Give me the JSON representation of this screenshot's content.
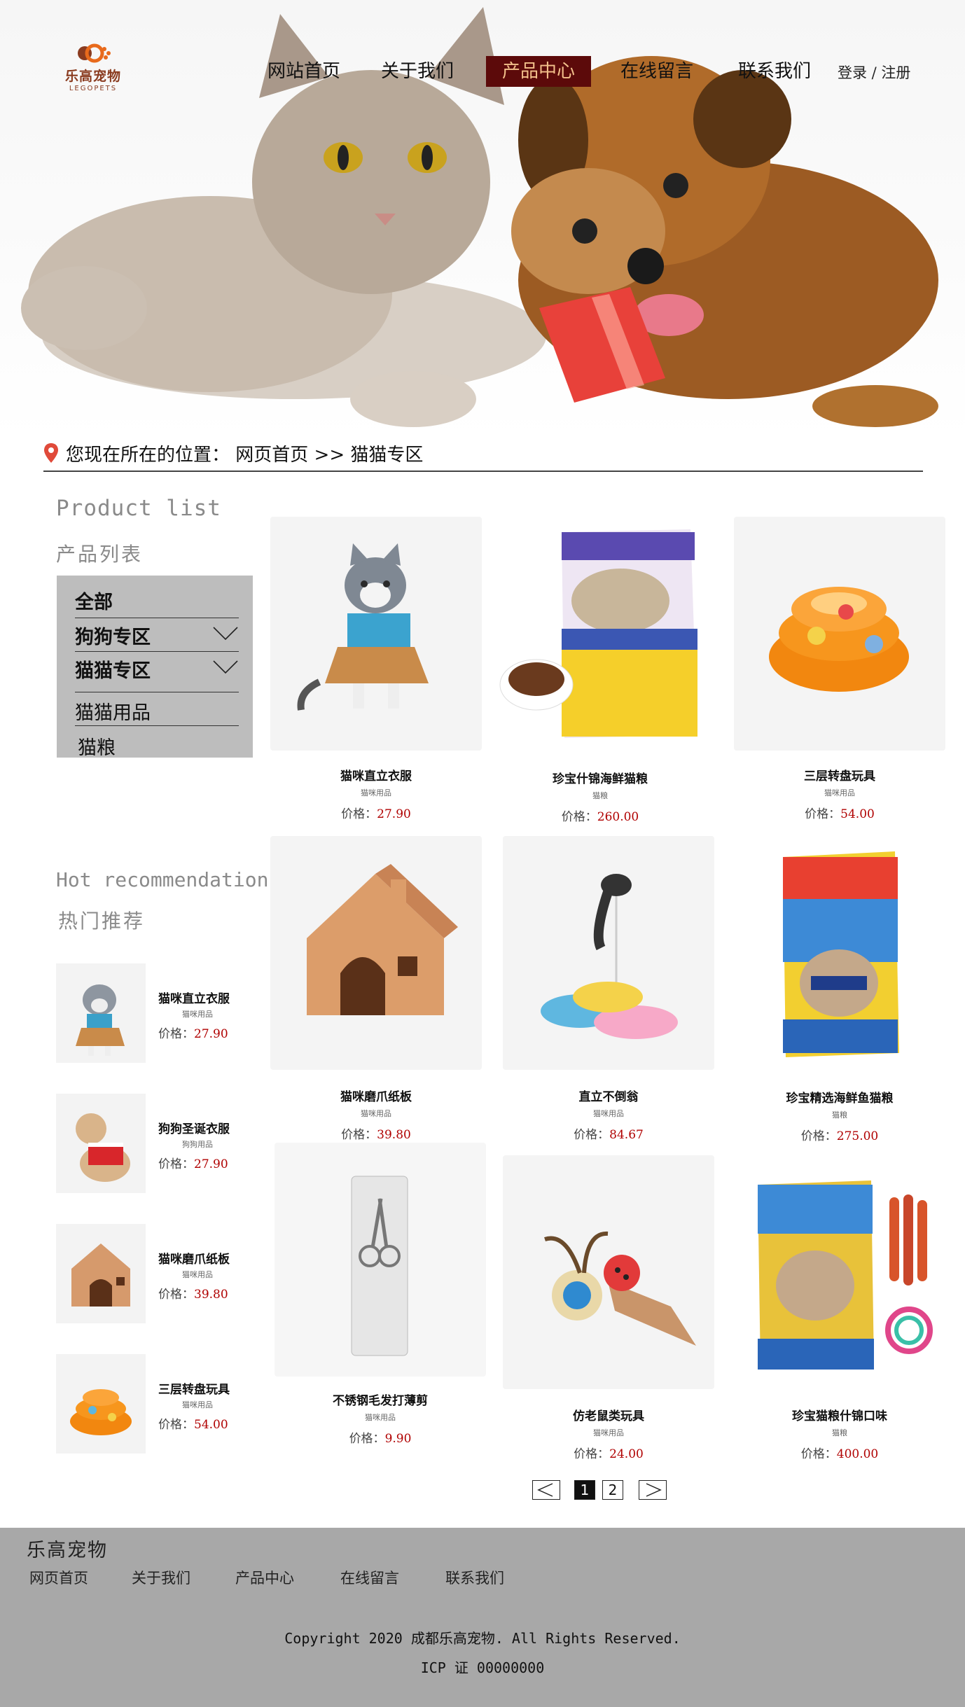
{
  "brand": {
    "name_cn": "乐高宠物",
    "name_en": "LEGOPETS"
  },
  "nav": {
    "items": [
      "网站首页",
      "关于我们",
      "产品中心",
      "在线留言",
      "联系我们"
    ],
    "active_index": 2,
    "login": "登录 / 注册"
  },
  "breadcrumb": {
    "text": "您现在所在的位置： 网页首页 >> 猫猫专区"
  },
  "sidebar": {
    "title_en": "Product list",
    "title_cn": "产品列表",
    "categories": [
      "全部",
      "狗狗专区",
      "猫猫专区",
      "猫猫用品",
      "猫粮"
    ]
  },
  "hot": {
    "title_en": "Hot recommendation",
    "title_cn": "热门推荐",
    "items": [
      {
        "name": "猫咪直立衣服",
        "category": "猫咪用品",
        "price_label": "价格：",
        "price": "27.90"
      },
      {
        "name": "狗狗圣诞衣服",
        "category": "狗狗用品",
        "price_label": "价格：",
        "price": "27.90"
      },
      {
        "name": "猫咪磨爪纸板",
        "category": "猫咪用品",
        "price_label": "价格：",
        "price": "39.80"
      },
      {
        "name": "三层转盘玩具",
        "category": "猫咪用品",
        "price_label": "价格：",
        "price": "54.00"
      }
    ]
  },
  "products": [
    {
      "name": "猫咪直立衣服",
      "category": "猫咪用品",
      "price_label": "价格：",
      "price": "27.90"
    },
    {
      "name": "珍宝什锦海鲜猫粮",
      "category": "猫粮",
      "price_label": "价格：",
      "price": "260.00"
    },
    {
      "name": "三层转盘玩具",
      "category": "猫咪用品",
      "price_label": "价格：",
      "price": "54.00"
    },
    {
      "name": "猫咪磨爪纸板",
      "category": "猫咪用品",
      "price_label": "价格：",
      "price": "39.80"
    },
    {
      "name": "直立不倒翁",
      "category": "猫咪用品",
      "price_label": "价格：",
      "price": "84.67"
    },
    {
      "name": "珍宝精选海鲜鱼猫粮",
      "category": "猫粮",
      "price_label": "价格：",
      "price": "275.00"
    },
    {
      "name": "不锈钢毛发打薄剪",
      "category": "猫咪用品",
      "price_label": "价格：",
      "price": "9.90"
    },
    {
      "name": "仿老鼠类玩具",
      "category": "猫咪用品",
      "price_label": "价格：",
      "price": "24.00"
    },
    {
      "name": "珍宝猫粮什锦口味",
      "category": "猫粮",
      "price_label": "价格：",
      "price": "400.00"
    }
  ],
  "pagination": {
    "prev": "<",
    "pages": [
      "1",
      "2"
    ],
    "next": ">"
  },
  "footer": {
    "brand": "乐高宠物",
    "links": [
      "网页首页",
      "关于我们",
      "产品中心",
      "在线留言",
      "联系我们"
    ],
    "copyright": "Copyright 2020 成都乐高宠物. All Rights Reserved.",
    "icp": "ICP 证 00000000"
  },
  "colors": {
    "nav_active_bg": "#5c0a0a",
    "nav_active_text": "#f3c08b",
    "price": "#b00000",
    "footer_bg": "#a8a8a8",
    "category_box": "#bdbdbd"
  }
}
